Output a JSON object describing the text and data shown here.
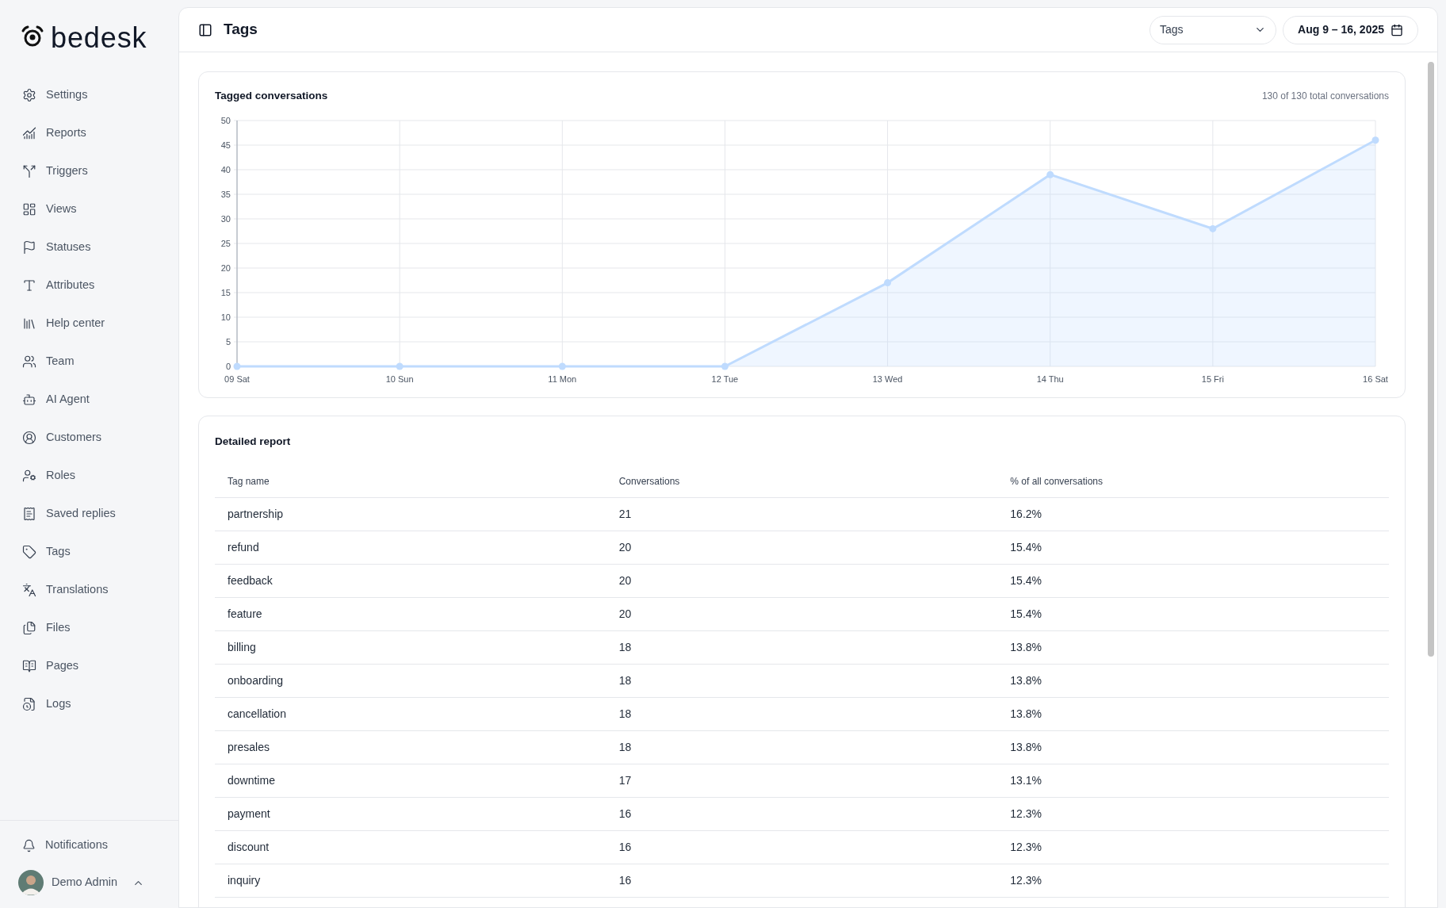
{
  "logo": {
    "text": "bedesk"
  },
  "sidebar": {
    "items": [
      {
        "label": "Settings"
      },
      {
        "label": "Reports"
      },
      {
        "label": "Triggers"
      },
      {
        "label": "Views"
      },
      {
        "label": "Statuses"
      },
      {
        "label": "Attributes"
      },
      {
        "label": "Help center"
      },
      {
        "label": "Team"
      },
      {
        "label": "AI Agent"
      },
      {
        "label": "Customers"
      },
      {
        "label": "Roles"
      },
      {
        "label": "Saved replies"
      },
      {
        "label": "Tags"
      },
      {
        "label": "Translations"
      },
      {
        "label": "Files"
      },
      {
        "label": "Pages"
      },
      {
        "label": "Logs"
      }
    ],
    "notifications": "Notifications",
    "user": "Demo Admin"
  },
  "header": {
    "title": "Tags",
    "select": "Tags",
    "date_range": "Aug 9 – 16, 2025"
  },
  "chart_card": {
    "title": "Tagged conversations",
    "summary": "130 of 130 total conversations",
    "chart_data": {
      "type": "area",
      "categories": [
        "09 Sat",
        "10 Sun",
        "11 Mon",
        "12 Tue",
        "13 Wed",
        "14 Thu",
        "15 Fri",
        "16 Sat"
      ],
      "series": [
        {
          "color": "#bfdbfe",
          "values": [
            0,
            0,
            0,
            0,
            17,
            39,
            28,
            46
          ]
        }
      ],
      "grid": true,
      "ylim": [
        0,
        50
      ],
      "yticks": [
        0,
        5,
        10,
        15,
        20,
        25,
        30,
        35,
        40,
        45,
        50
      ]
    }
  },
  "report": {
    "title": "Detailed report",
    "columns": [
      "Tag name",
      "Conversations",
      "% of all conversations"
    ],
    "rows": [
      [
        "partnership",
        "21",
        "16.2%"
      ],
      [
        "refund",
        "20",
        "15.4%"
      ],
      [
        "feedback",
        "20",
        "15.4%"
      ],
      [
        "feature",
        "20",
        "15.4%"
      ],
      [
        "billing",
        "18",
        "13.8%"
      ],
      [
        "onboarding",
        "18",
        "13.8%"
      ],
      [
        "cancellation",
        "18",
        "13.8%"
      ],
      [
        "presales",
        "18",
        "13.8%"
      ],
      [
        "downtime",
        "17",
        "13.1%"
      ],
      [
        "payment",
        "16",
        "12.3%"
      ],
      [
        "discount",
        "16",
        "12.3%"
      ],
      [
        "inquiry",
        "16",
        "12.3%"
      ]
    ]
  }
}
